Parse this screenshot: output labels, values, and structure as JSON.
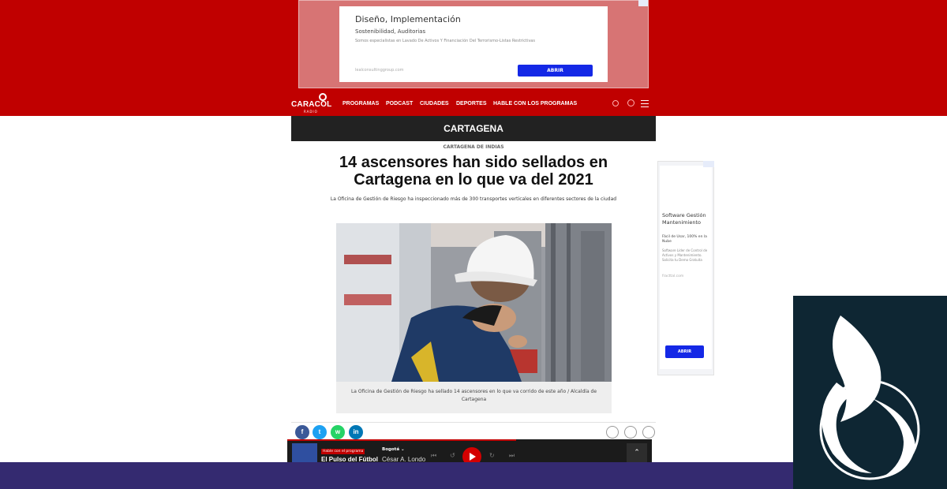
{
  "top_ad": {
    "title": "Diseño, Implementación",
    "subtitle": "Sostenibilidad, Auditorias",
    "description": "Somos especialistas en Lavado De Activos Y Financiación Del Terrorismo-Listas Restrictivas",
    "url": "lealconsultinggroup.com",
    "button_label": "ABRIR"
  },
  "nav": {
    "logo_name": "CARACOL",
    "logo_sub": "RADIO",
    "items": [
      "PROGRAMAS",
      "PODCAST",
      "CIUDADES",
      "DEPORTES",
      "HABLE CON LOS PROGRAMAS"
    ]
  },
  "section": {
    "title": "CARTAGENA"
  },
  "article": {
    "kicker": "CARTAGENA DE INDIAS",
    "headline": "14 ascensores han sido sellados en Cartagena en lo que va del 2021",
    "subtitle": "La Oficina de Gestión de Riesgo ha inspeccionado más de 300 transportes verticales en diferentes sectores de la ciudad",
    "caption": "La Oficina de Gestión de Riesgo ha sellado 14 ascensores en lo que va corrido de este año / Alcaldía de Cartagena"
  },
  "share": {
    "icons": [
      "facebook-icon",
      "twitter-icon",
      "whatsapp-icon",
      "linkedin-icon"
    ],
    "glyphs": [
      "f",
      "t",
      "w",
      "in"
    ],
    "colors": [
      "#3b5998",
      "#1da1f2",
      "#25d366",
      "#0077b5"
    ]
  },
  "player": {
    "live_label": "Hable con el programa",
    "show": "El Pulso del Fútbol",
    "city": "Bogotá ⌄",
    "host": "César A. Londo",
    "up_glyph": "⌃"
  },
  "side_ad": {
    "title": "Software Gestión Mantenimiento",
    "subtitle": "Fácil de Usar, 100% en la Nube",
    "description": "Software Líder de Control de Activos y Mantenimiento. Solicita tu Demo Gratuita",
    "url": "fracttal.com",
    "button_label": "ABRIR"
  },
  "colors": {
    "brand_red": "#c00000",
    "dark_bar": "#222222",
    "brand_panel": "#0e2633",
    "bottom_band": "#342a70",
    "ad_button": "#1428e6"
  }
}
